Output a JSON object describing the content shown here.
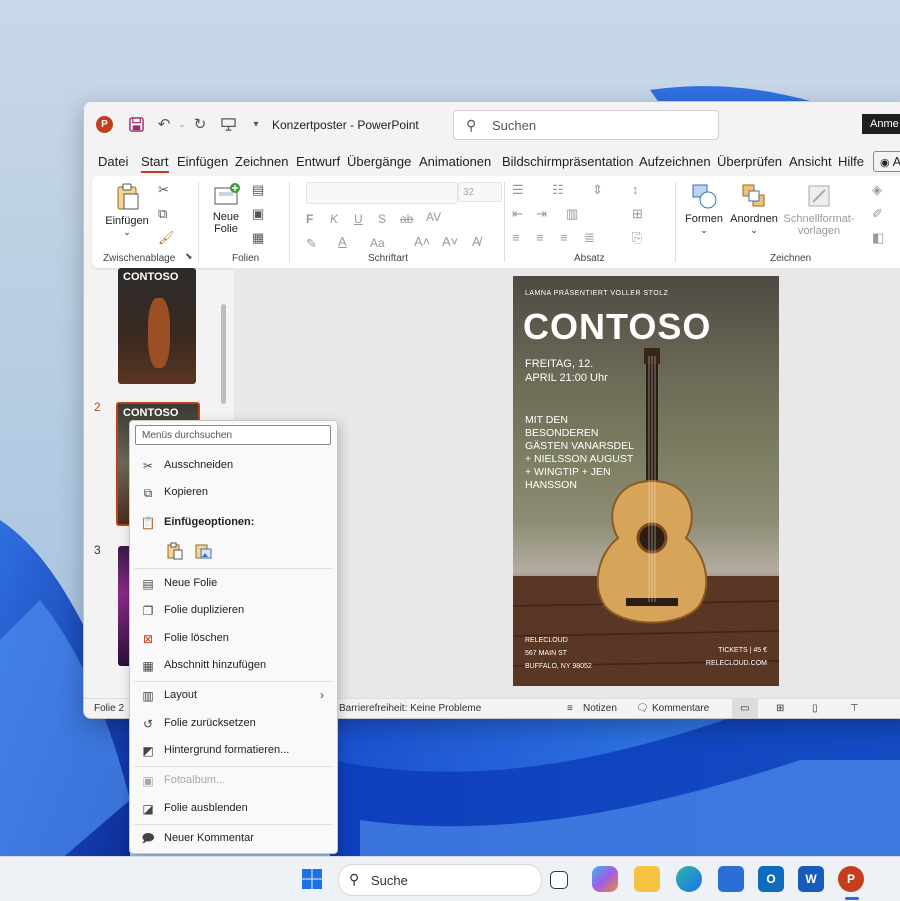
{
  "window": {
    "doc_title": "Konzertposter  -  PowerPoint",
    "search_placeholder": "Suchen",
    "signin_label": "Anme",
    "accent": "#c43e1c"
  },
  "menubar": {
    "items": [
      "Datei",
      "Start",
      "Einfügen",
      "Zeichnen",
      "Entwurf",
      "Übergänge",
      "Animationen",
      "Bildschirmpräsentation",
      "Aufzeichnen",
      "Überprüfen",
      "Ansicht",
      "Hilfe"
    ],
    "active": "Start",
    "right_toggle": "A"
  },
  "ribbon": {
    "groups": [
      "Zwischenablage",
      "Folien",
      "Schriftart",
      "Absatz",
      "Zeichnen"
    ],
    "paste_label": "Einfügen",
    "new_slide_label_1": "Neue",
    "new_slide_label_2": "Folie",
    "font_size": "32",
    "shapes_label": "Formen",
    "arrange_label": "Anordnen",
    "quickstyles_label_1": "Schnellformat-",
    "quickstyles_label_2": "vorlagen"
  },
  "thumbnails": {
    "numbers": [
      "2",
      "3"
    ],
    "thumb1_title": "CONTOSO",
    "thumb2_title": "CONTOSO"
  },
  "slide": {
    "presenter": "LAMNA PRÄSENTIERT VOLLER STOLZ",
    "title": "CONTOSO",
    "date_1": "FREITAG, 12.",
    "date_2": "APRIL 21:00 Uhr",
    "lineup": [
      "MIT DEN",
      "BESONDEREN",
      "GÄSTEN VANARSDEL",
      "+ NIELSSON AUGUST",
      "+ WINGTIP + JEN",
      "HANSSON"
    ],
    "venue": [
      "RELECLOUD",
      "567 MAIN ST",
      "BUFFALO, NY 98052"
    ],
    "tickets": "TICKETS  |  45 €",
    "website": "RELECLOUD.COM"
  },
  "statusbar": {
    "slide_info": "Folie 2",
    "accessibility": "Barrierefreiheit: Keine Probleme",
    "notes": "Notizen",
    "comments": "Kommentare"
  },
  "context_menu": {
    "search_placeholder": "Menüs durchsuchen",
    "items": {
      "cut": "Ausschneiden",
      "copy": "Kopieren",
      "paste_options": "Einfügeoptionen:",
      "new_slide": "Neue Folie",
      "duplicate": "Folie duplizieren",
      "delete": "Folie löschen",
      "add_section": "Abschnitt hinzufügen",
      "layout": "Layout",
      "reset": "Folie zurücksetzen",
      "format_bg": "Hintergrund formatieren...",
      "photo_album": "Fotoalbum...",
      "hide": "Folie ausblenden",
      "new_comment": "Neuer Kommentar"
    }
  },
  "taskbar": {
    "search_label": "Suche",
    "apps": [
      "windows-start",
      "search",
      "task-view",
      "copilot",
      "file-explorer",
      "edge",
      "store",
      "outlook",
      "word",
      "powerpoint"
    ]
  }
}
